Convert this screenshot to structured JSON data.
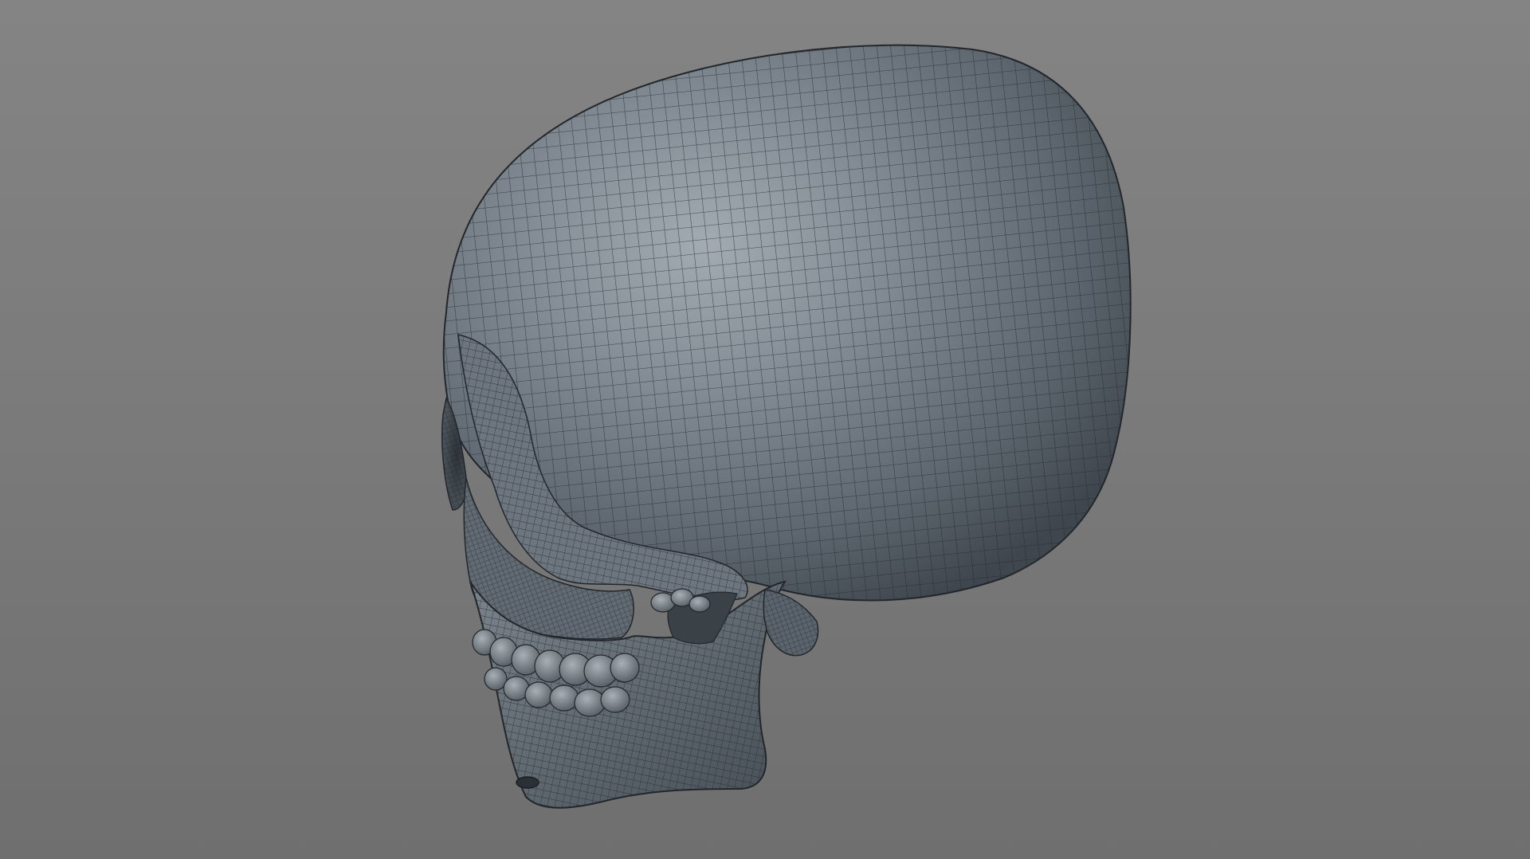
{
  "viewport": {
    "view": "perspective",
    "display_mode": "smooth-shaded-wireframe",
    "colors": {
      "background_top": "#848484",
      "background_bottom": "#6f6f6f",
      "mesh_shade_light": "#9ea6ad",
      "mesh_shade_mid": "#6a737b",
      "mesh_shade_dark": "#3b4249",
      "wire": "#23282d"
    }
  },
  "model": {
    "subject": "skull",
    "topology": "quad-mesh"
  }
}
